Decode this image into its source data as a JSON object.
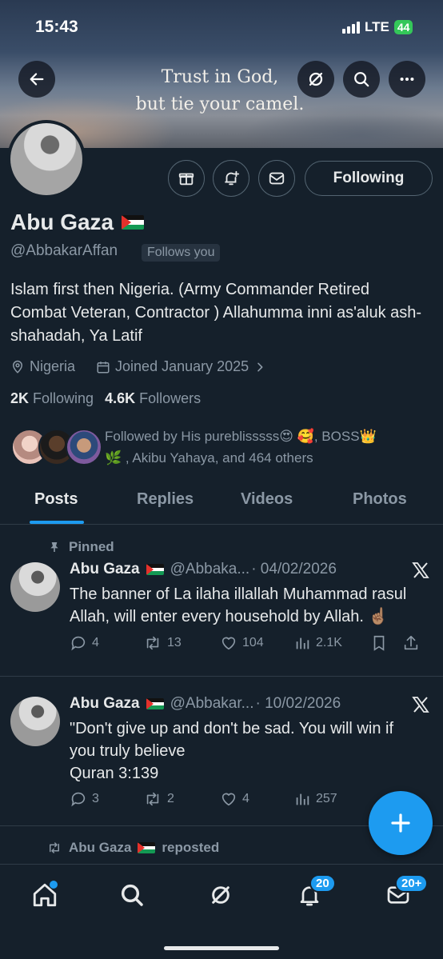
{
  "status_bar": {
    "time": "15:43",
    "network": "LTE",
    "battery": "44"
  },
  "banner": {
    "line1": "Trust in God,",
    "line2": "but tie your camel."
  },
  "header_buttons": {
    "back": "arrow-left-icon",
    "grok": "grok-icon",
    "search": "search-icon",
    "more": "more-icon"
  },
  "profile": {
    "name": "Abu Gaza",
    "handle": "@AbbakarAffan",
    "follows_you": "Follows you",
    "following_button": "Following",
    "bio": "Islam first then Nigeria. (Army Commander Retired Combat Veteran, Contractor ) Allahumma inni as'aluk ash-shahadah, Ya Latif",
    "location": "Nigeria",
    "joined": "Joined January 2025",
    "following_count": "2K",
    "following_label": "Following",
    "followers_count": "4.6K",
    "followers_label": "Followers",
    "followed_by_line1": "Followed by His pureblisssss😍 🥰, BOSS👑",
    "followed_by_line2": "🌿 , Akibu Yahaya, and 464 others"
  },
  "tabs": [
    "Posts",
    "Replies",
    "Videos",
    "Photos"
  ],
  "active_tab": "Posts",
  "posts": [
    {
      "pinned_label": "Pinned",
      "name": "Abu Gaza",
      "handle": "@Abbaka...",
      "date": "· 04/02/2026",
      "text": "The banner of La ilaha illallah Muhammad rasul Allah, will enter every household by Allah. ☝🏽",
      "replies": "4",
      "reposts": "13",
      "likes": "104",
      "views": "2.1K"
    },
    {
      "name": "Abu Gaza",
      "handle": "@Abbakar...",
      "date": "· 10/02/2026",
      "text_line1": "\"Don't give up and don't be sad. You will win if you truly believe",
      "text_line2": "Quran 3:139",
      "replies": "3",
      "reposts": "2",
      "likes": "4",
      "views": "257"
    }
  ],
  "repost_row": {
    "label": "Abu Gaza",
    "suffix": "reposted"
  },
  "bottom_nav": {
    "notifications_badge": "20",
    "messages_badge": "20+"
  },
  "colors": {
    "background": "#15202b",
    "accent": "#1d9bf0",
    "muted": "#8b98a5",
    "text": "#e7e9ea"
  }
}
